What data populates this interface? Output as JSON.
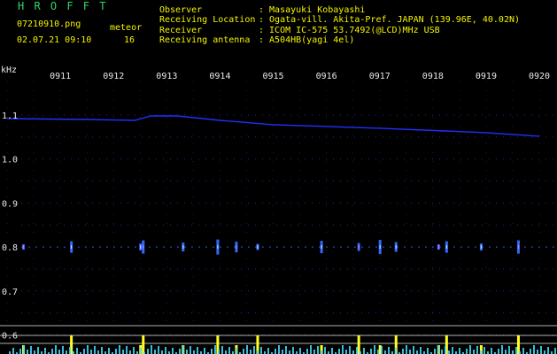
{
  "header": {
    "brand": "H R O F F T",
    "filename": "07210910.png",
    "meteor_label": "meteor",
    "datetime": "02.07.21 09:10",
    "meteor_count": "16",
    "fields": [
      {
        "label": "Observer",
        "value": ": Masayuki Kobayashi"
      },
      {
        "label": "Receiving Location",
        "value": ": Ogata-vill. Akita-Pref. JAPAN (139.96E, 40.02N)"
      },
      {
        "label": "Receiver",
        "value": ": ICOM IC-575 53.7492(@LCD)MHz USB"
      },
      {
        "label": "Receiving antenna",
        "value": ": A504HB(yagi 4el)"
      }
    ]
  },
  "colors": {
    "background": "#000000",
    "header_text": "#f4f400",
    "brand": "#2fd66a",
    "grid_dots": "#3a4cff",
    "echo_trace": "#2030ff",
    "meteor_marks": "#2d6bff",
    "baseline_lines": "#cfcfcf",
    "histogram_yellow": "#ffff20",
    "histogram_cyan": "#40e0ff"
  },
  "chart_data": {
    "type": "heatmap",
    "y_unit": "kHz",
    "y_ticks": [
      "1.1",
      "1.0",
      "0.9",
      "0.8",
      "0.7",
      "0.6"
    ],
    "x_ticks": [
      "0911",
      "0912",
      "0913",
      "0914",
      "0915",
      "0916",
      "0917",
      "0918",
      "0919",
      "0920"
    ],
    "x_range": [
      "0910",
      "0920"
    ],
    "y_range": [
      0.58,
      1.12
    ],
    "carrier_trace": {
      "x_minutes": [
        0,
        1.5,
        2.4,
        2.7,
        3.2,
        4.0,
        5.0,
        7.0,
        9.0,
        10.0
      ],
      "freq_khz": [
        1.092,
        1.09,
        1.088,
        1.098,
        1.098,
        1.088,
        1.078,
        1.07,
        1.06,
        1.052
      ]
    },
    "meteor_echoes": {
      "band_khz": 0.8,
      "x_minutes": [
        0.3,
        1.2,
        2.5,
        2.55,
        3.3,
        3.95,
        4.3,
        4.7,
        5.9,
        6.6,
        7.0,
        7.3,
        8.1,
        8.25,
        8.9,
        9.6
      ]
    }
  }
}
